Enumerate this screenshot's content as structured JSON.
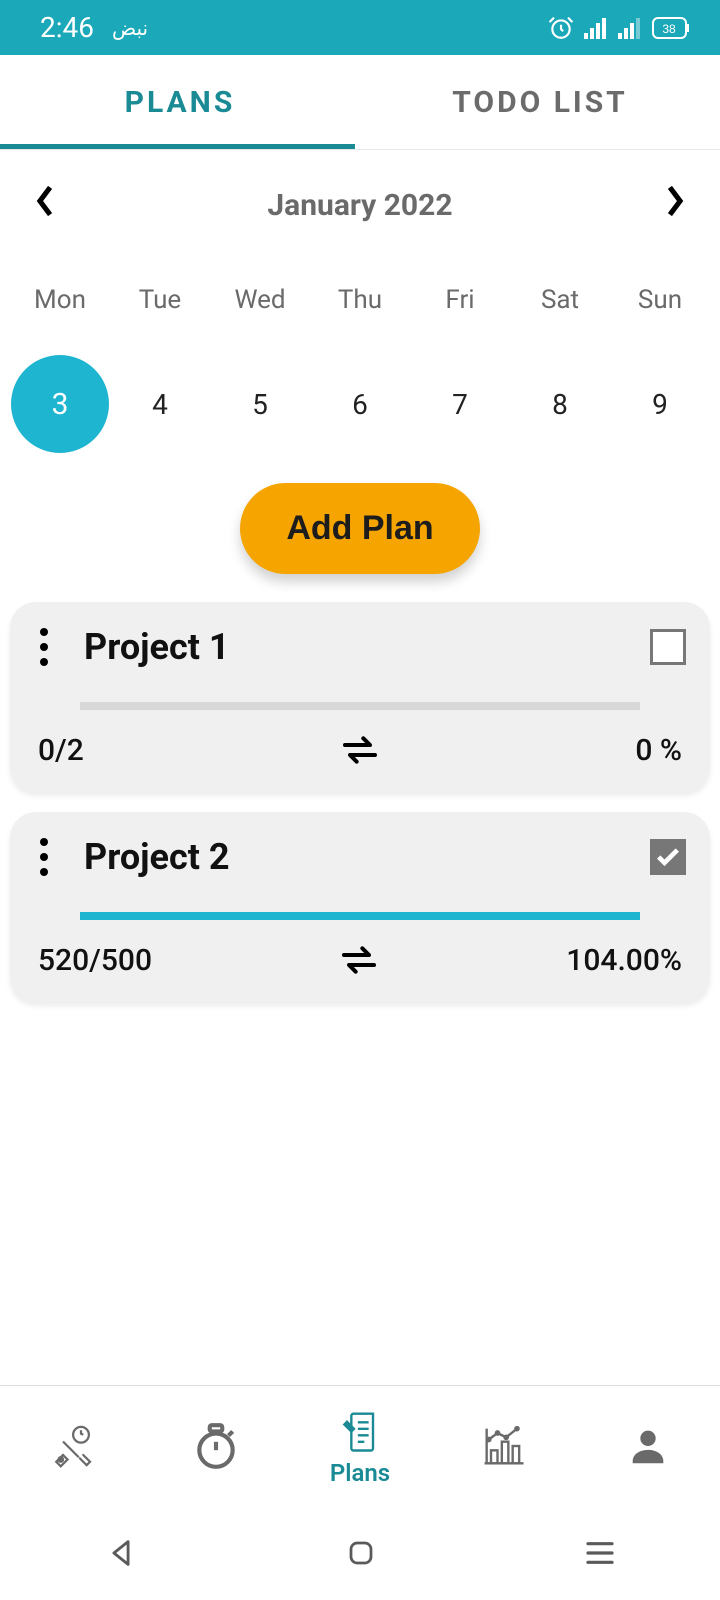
{
  "status": {
    "time": "2:46",
    "arabic": "نبض",
    "battery": "38"
  },
  "tabs": {
    "plans": "PLANS",
    "todo": "TODO LIST"
  },
  "month": {
    "title": "January 2022"
  },
  "week": {
    "d0": "Mon",
    "d1": "Tue",
    "d2": "Wed",
    "d3": "Thu",
    "d4": "Fri",
    "d5": "Sat",
    "d6": "Sun"
  },
  "dates": {
    "n0": "3",
    "n1": "4",
    "n2": "5",
    "n3": "6",
    "n4": "7",
    "n5": "8",
    "n6": "9"
  },
  "actions": {
    "addPlan": "Add Plan"
  },
  "projects": [
    {
      "title": "Project 1",
      "counter": "0/2",
      "percent": "0 %",
      "progress": 0,
      "checked": false
    },
    {
      "title": "Project 2",
      "counter": "520/500",
      "percent": "104.00%",
      "progress": 100,
      "checked": true
    }
  ],
  "bottomNav": {
    "plans": "Plans"
  }
}
